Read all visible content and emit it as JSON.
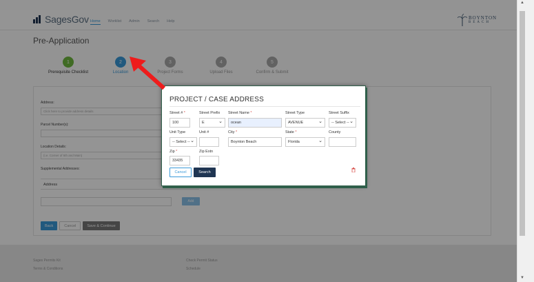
{
  "app": {
    "logo_text": "SagesGov"
  },
  "nav": {
    "items": [
      "Home",
      "Worklist",
      "Admin",
      "Search",
      "Help"
    ]
  },
  "city_logo": {
    "line1": "BOYNTON",
    "line2": "BEACH"
  },
  "page_title": "Pre-Application",
  "steps": [
    {
      "num": "1",
      "label": "Prerequisite Checklist",
      "state": "done"
    },
    {
      "num": "2",
      "label": "Location",
      "state": "active"
    },
    {
      "num": "3",
      "label": "Project Forms",
      "state": "todo"
    },
    {
      "num": "4",
      "label": "Upload Files",
      "state": "todo"
    },
    {
      "num": "5",
      "label": "Confirm & Submit",
      "state": "todo"
    }
  ],
  "form": {
    "address_label": "Address:",
    "address_placeholder": "Click here to provide address details",
    "parcel_label": "Parcel Number(s):",
    "location_label": "Location Details:",
    "location_placeholder": "(i.e. Corner of 5th and Main)",
    "supplemental_label": "Supplemental Addresses:",
    "address_col": "Address",
    "add_button": "Add",
    "back_button": "Back",
    "cancel_button": "Cancel",
    "save_button": "Save & Continue"
  },
  "footer": {
    "col1": [
      "Sages Permits Kit",
      "Terms & Conditions"
    ],
    "col2": [
      "Check Permit Status",
      "Schedule"
    ]
  },
  "modal": {
    "title": "PROJECT / CASE ADDRESS",
    "street_no_label": "Street #",
    "street_no_value": "100",
    "street_prefix_label": "Street Prefix",
    "street_prefix_value": "E",
    "street_name_label": "Street Name",
    "street_name_value": "ocean",
    "street_type_label": "Street Type",
    "street_type_value": "AVENUE",
    "street_suffix_label": "Street Suffix",
    "street_suffix_value": "-- Select --",
    "unit_type_label": "Unit Type",
    "unit_type_value": "-- Select --",
    "unit_no_label": "Unit #",
    "unit_no_value": "",
    "city_label": "City",
    "city_value": "Boynton Beach",
    "state_label": "State",
    "state_value": "Florida",
    "county_label": "County",
    "county_value": "",
    "zip_label": "Zip",
    "zip_value": "33435",
    "zip_ext_label": "Zip Extn",
    "zip_ext_value": "",
    "cancel_button": "Cancel",
    "search_button": "Search",
    "required_mark": "*"
  },
  "colors": {
    "accent": "#3a9ad9",
    "primary_dark": "#1f3552",
    "done_green": "#6fb93e",
    "required_red": "#d9534f",
    "annotation_arrow": "#ee1c1c"
  },
  "icons": {
    "trash": "trash-icon",
    "annotation": "red-arrow-icon"
  }
}
